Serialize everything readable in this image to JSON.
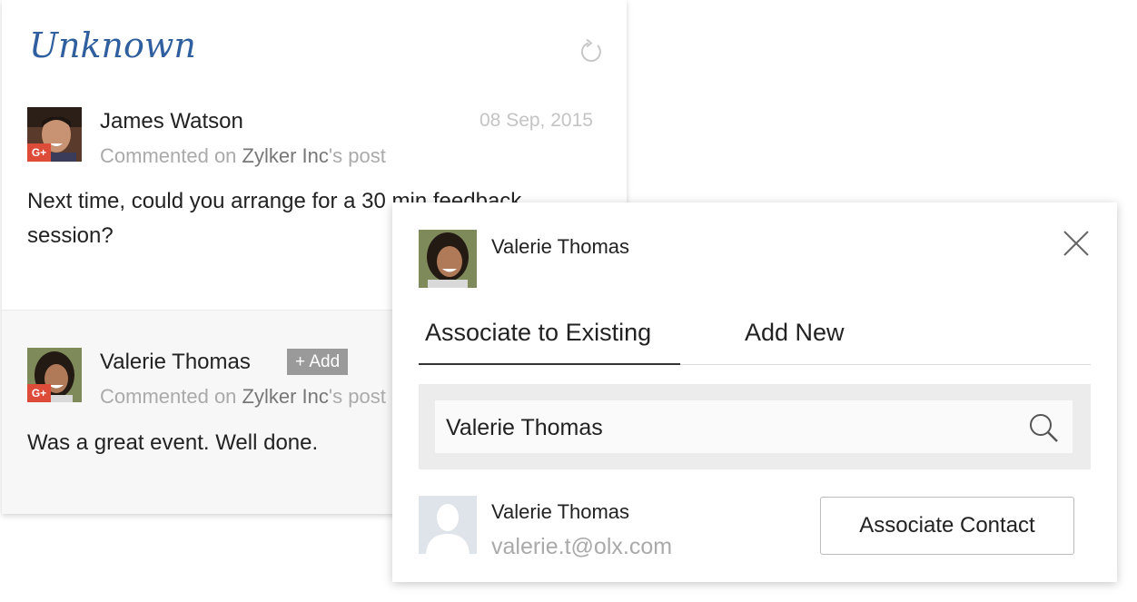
{
  "feed": {
    "title": "Unknown",
    "comments": [
      {
        "author": "James Watson",
        "date": "08 Sep, 2015",
        "meta_prefix": "Commented on",
        "meta_page": "Zylker Inc",
        "meta_suffix": "'s post",
        "text": "Next time, could you arrange for a 30 min feedback session?",
        "network_badge": "G+"
      },
      {
        "author": "Valerie Thomas",
        "add_label": "+ Add",
        "meta_prefix": "Commented on",
        "meta_page": "Zylker Inc",
        "meta_suffix": "'s post",
        "text": "Was a great event. Well done.",
        "network_badge": "G+"
      }
    ]
  },
  "popup": {
    "contact_name": "Valerie Thomas",
    "tabs": [
      {
        "label": "Associate to Existing",
        "active": true
      },
      {
        "label": "Add New",
        "active": false
      }
    ],
    "search": {
      "value": "Valerie Thomas"
    },
    "result": {
      "name": "Valerie Thomas",
      "email": "valerie.t@olx.com",
      "button_label": "Associate Contact"
    }
  },
  "icons": [
    "refresh-icon",
    "gplus-icon",
    "close-icon",
    "search-icon",
    "avatar-placeholder-icon"
  ],
  "colors": {
    "title_blue": "#2f5f9e",
    "gplus_red": "#dd4b39",
    "add_badge_gray": "#9a9a9a"
  }
}
